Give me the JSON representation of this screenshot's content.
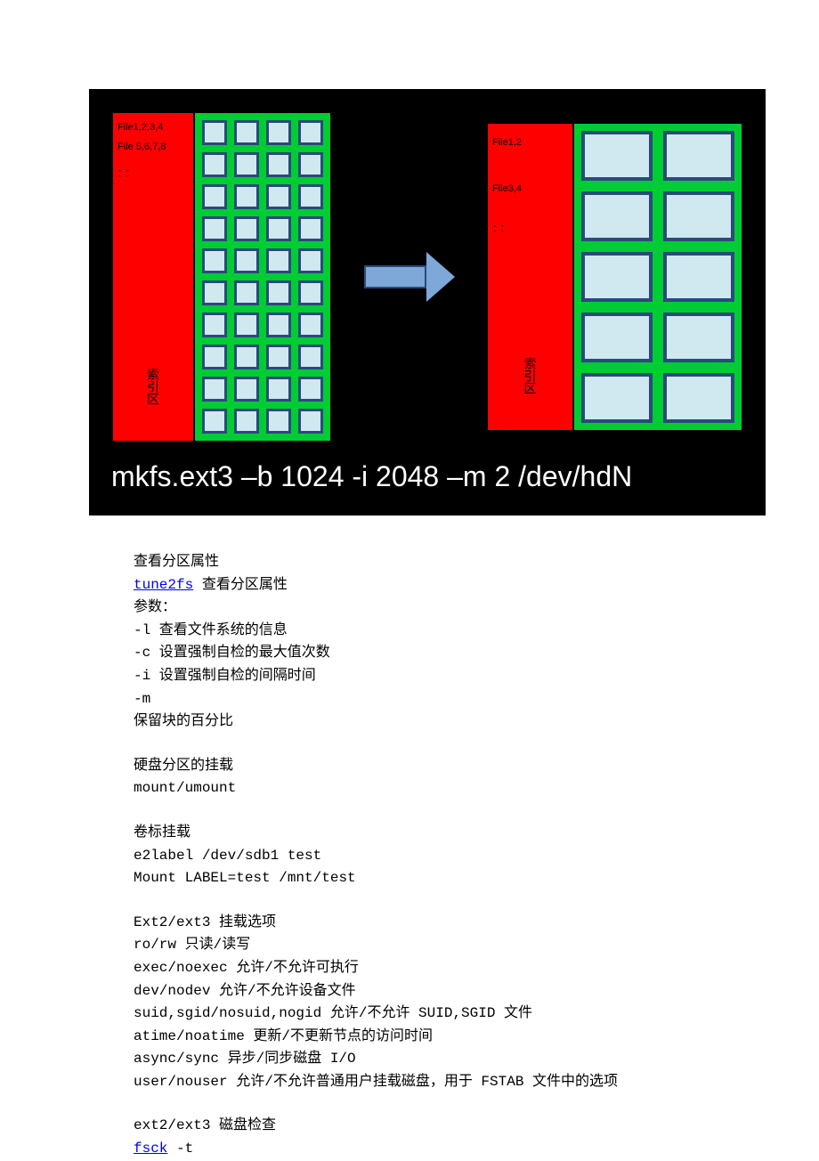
{
  "diagram": {
    "left_block": {
      "labels": [
        "File1,2,3,4",
        "File 5,6,7,8"
      ],
      "dots": "：：",
      "index_text": "索引区",
      "rows": 10,
      "cols": 4
    },
    "right_block": {
      "labels": [
        "File1,2",
        "File3,4"
      ],
      "dots": "：：",
      "index_text": "索引区",
      "rows": 5,
      "cols": 2
    },
    "command": "mkfs.ext3  –b  1024  -i 2048  –m 2 /dev/hdN"
  },
  "sections": {
    "view_partition": {
      "title": "查看分区属性",
      "link_text": "tune2fs",
      "link_suffix": " 查看分区属性",
      "params_label": "参数：",
      "params": [
        "-l 查看文件系统的信息",
        "-c 设置强制自检的最大值次数",
        "-i 设置强制自检的间隔时间",
        "-m",
        "保留块的百分比"
      ]
    },
    "mount_partition": {
      "title": "硬盘分区的挂载",
      "cmd": "mount/umount"
    },
    "label_mount": {
      "title": "卷标挂载",
      "lines": [
        "e2label /dev/sdb1 test",
        "Mount LABEL=test /mnt/test"
      ]
    },
    "mount_options": {
      "title": "Ext2/ext3 挂载选项",
      "lines": [
        "ro/rw 只读/读写",
        "exec/noexec 允许/不允许可执行",
        "dev/nodev 允许/不允许设备文件",
        "suid,sgid/nosuid,nogid 允许/不允许 SUID,SGID 文件",
        "atime/noatime 更新/不更新节点的访问时间",
        "async/sync 异步/同步磁盘 I/O",
        "user/nouser 允许/不允许普通用户挂载磁盘，用于 FSTAB 文件中的选项"
      ]
    },
    "disk_check": {
      "title": "ext2/ext3 磁盘检查",
      "link_text": "fsck",
      "link_suffix": " -t"
    }
  }
}
